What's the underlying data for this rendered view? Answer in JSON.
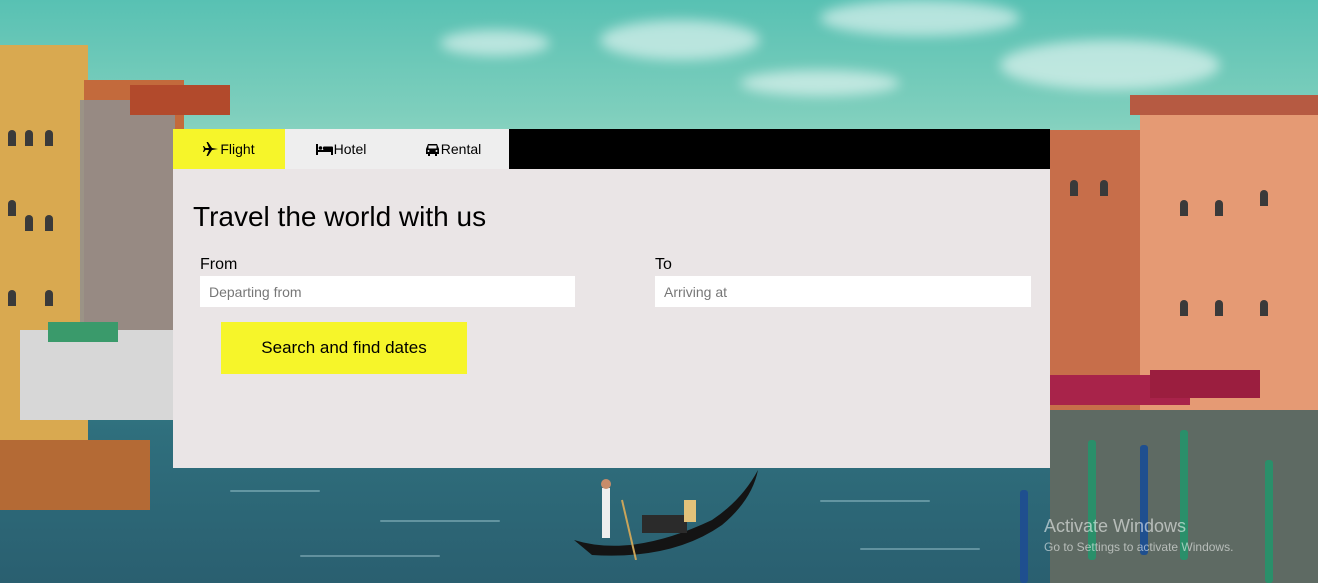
{
  "tabs": {
    "flight": {
      "label": "Flight",
      "icon": "plane-icon"
    },
    "hotel": {
      "label": "Hotel",
      "icon": "bed-icon"
    },
    "rental": {
      "label": "Rental",
      "icon": "car-icon"
    }
  },
  "form": {
    "title": "Travel the world with us",
    "from_label": "From",
    "from_placeholder": "Departing from",
    "from_value": "",
    "to_label": "To",
    "to_placeholder": "Arriving at",
    "to_value": "",
    "search_button": "Search and find dates"
  },
  "watermark": {
    "line1": "Activate Windows",
    "line2": "Go to Settings to activate Windows."
  },
  "colors": {
    "accent": "#f6f52a",
    "card_bg": "#eae5e6",
    "tabbar_bg": "#000000",
    "inactive_tab": "#eeeeee"
  }
}
